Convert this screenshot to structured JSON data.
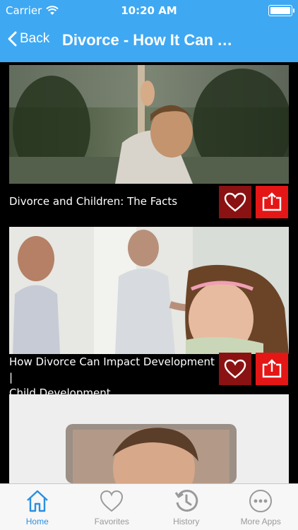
{
  "status": {
    "carrier": "Carrier",
    "time": "10:20 AM"
  },
  "nav": {
    "back_label": "Back",
    "title": "Divorce - How It Can A..."
  },
  "cards": [
    {
      "title": "Divorce and Children: The Facts"
    },
    {
      "title_line1": "How Divorce Can Impact Development |",
      "title_line2": "Child Development"
    }
  ],
  "tabs": [
    {
      "label": "Home",
      "icon": "home-icon",
      "active": true
    },
    {
      "label": "Favorites",
      "icon": "heart-icon",
      "active": false
    },
    {
      "label": "History",
      "icon": "history-icon",
      "active": false
    },
    {
      "label": "More Apps",
      "icon": "more-icon",
      "active": false
    }
  ],
  "colors": {
    "accent": "#3fa8f2",
    "fav_bg": "#8b1212",
    "share_bg": "#e51616",
    "tab_active": "#2b8fe0",
    "tab_inactive": "#9a9a9a"
  }
}
